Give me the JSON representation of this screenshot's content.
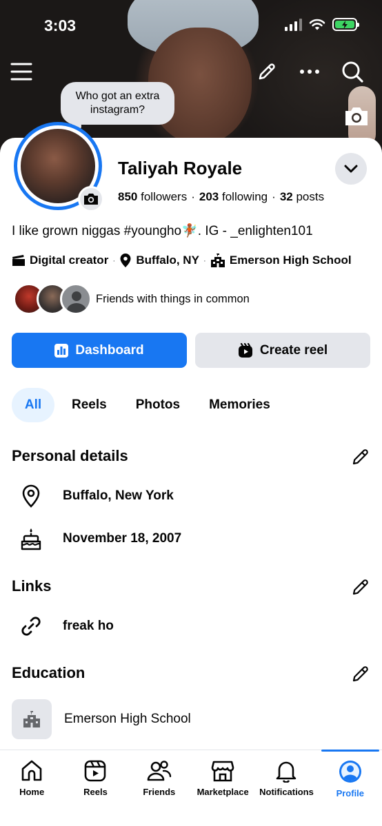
{
  "status_bar": {
    "time": "3:03"
  },
  "header": {
    "menu_icon": "hamburger-icon",
    "edit_icon": "pencil-icon",
    "more_icon": "more-icon",
    "search_icon": "search-icon",
    "cover_camera_icon": "camera-icon"
  },
  "note": {
    "text": "Who got an extra instagram?"
  },
  "profile": {
    "name": "Taliyah Royale",
    "followers_count": "850",
    "followers_label": "followers",
    "following_count": "203",
    "following_label": "following",
    "posts_count": "32",
    "posts_label": "posts",
    "bio": "I like grown niggas #youngho🧚🏾. IG - _enlighten101",
    "ring_color": "#1877f2"
  },
  "meta": {
    "category": "Digital creator",
    "location": "Buffalo, NY",
    "school": "Emerson High School"
  },
  "friends": {
    "text": "Friends with things in common"
  },
  "actions": {
    "dashboard": "Dashboard",
    "create_reel": "Create reel"
  },
  "tabs": [
    {
      "label": "All",
      "active": true
    },
    {
      "label": "Reels",
      "active": false
    },
    {
      "label": "Photos",
      "active": false
    },
    {
      "label": "Memories",
      "active": false
    }
  ],
  "personal_details": {
    "title": "Personal details",
    "location": "Buffalo, New York",
    "birthday": "November 18, 2007"
  },
  "links": {
    "title": "Links",
    "link": "freak ho"
  },
  "education": {
    "title": "Education",
    "school": "Emerson High School"
  },
  "bottom_nav": [
    {
      "label": "Home",
      "icon": "home-icon",
      "active": false
    },
    {
      "label": "Reels",
      "icon": "reels-icon",
      "active": false
    },
    {
      "label": "Friends",
      "icon": "friends-icon",
      "active": false
    },
    {
      "label": "Marketplace",
      "icon": "marketplace-icon",
      "active": false
    },
    {
      "label": "Notifications",
      "icon": "bell-icon",
      "active": false
    },
    {
      "label": "Profile",
      "icon": "profile-icon",
      "active": true
    }
  ],
  "colors": {
    "accent": "#1877f2",
    "secondary_bg": "#e4e6eb",
    "text": "#050505"
  }
}
